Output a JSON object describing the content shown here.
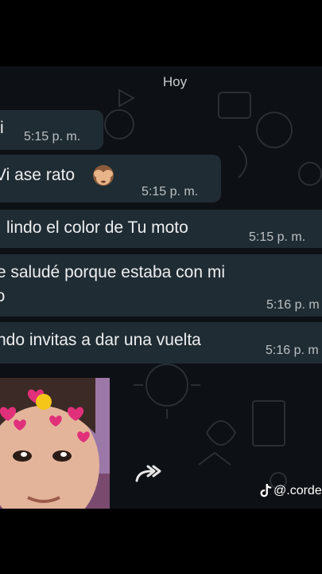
{
  "chat": {
    "date_label": "Hoy",
    "messages": [
      {
        "text": "i",
        "time": "5:15 p. m."
      },
      {
        "text": "Vi ase rato",
        "time": "5:15 p. m."
      },
      {
        "text": "lindo el color de Tu moto",
        "time": "5:15 p. m."
      },
      {
        "text_line1": "te saludé porque estaba con mi",
        "text_line2": "io",
        "time": "5:16 p. m"
      },
      {
        "text": "ndo invitas a dar una vuelta",
        "time": "5:16 p. m"
      }
    ]
  },
  "media": {
    "photo_icon": "girl-photo-with-hearts",
    "forward_icon": "forward-icon"
  },
  "watermark": {
    "logo_icon": "tiktok-icon",
    "handle": "@.corde"
  }
}
